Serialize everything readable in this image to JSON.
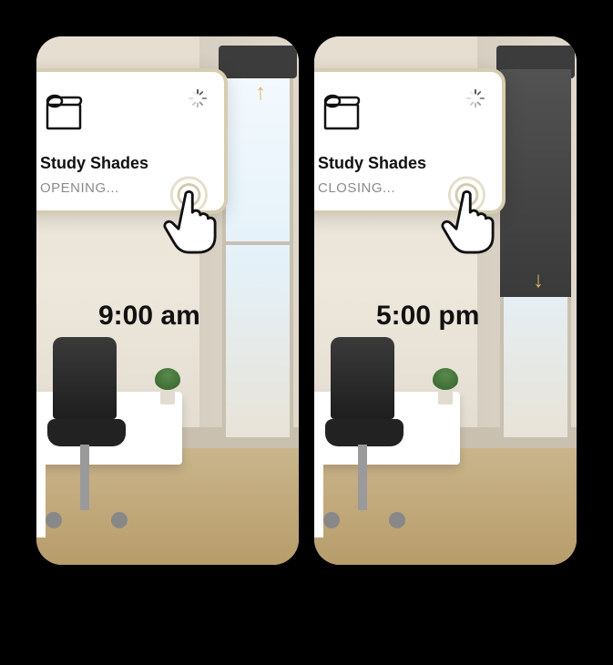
{
  "panels": [
    {
      "mode": "opening",
      "card": {
        "title": "Study Shades",
        "status": "OPENING..."
      },
      "arrow": "↑",
      "time": "9:00 am"
    },
    {
      "mode": "closing",
      "card": {
        "title": "Study Shades",
        "status": "CLOSING..."
      },
      "arrow": "↓",
      "time": "5:00 pm"
    }
  ]
}
